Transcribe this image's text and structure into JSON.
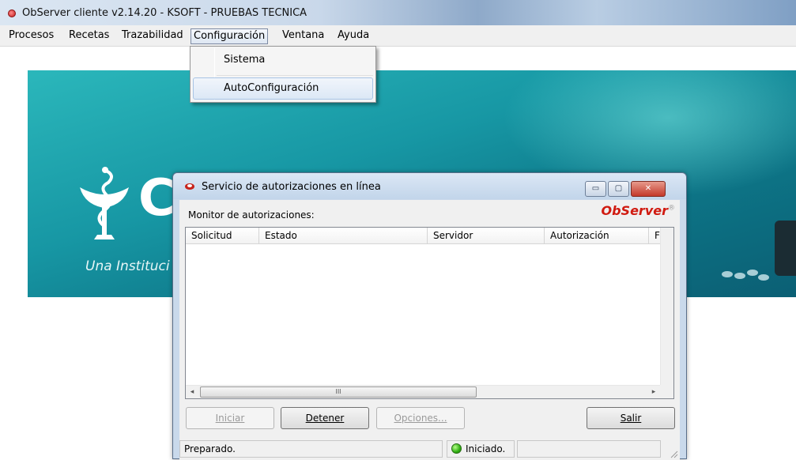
{
  "app": {
    "title": "ObServer cliente v2.14.20 - KSOFT - PRUEBAS TECNICA"
  },
  "menubar": {
    "items": [
      {
        "label": "Procesos"
      },
      {
        "label": "Recetas"
      },
      {
        "label": "Trazabilidad"
      },
      {
        "label": "Configuración",
        "active": true
      },
      {
        "label": "Ventana"
      },
      {
        "label": "Ayuda"
      }
    ]
  },
  "config_menu": {
    "items": [
      {
        "label": "Sistema"
      },
      {
        "label": "AutoConfiguración",
        "highlighted": true
      }
    ]
  },
  "banner": {
    "logo_text": "Cl",
    "slogan": "Una Instituci"
  },
  "dialog": {
    "title": "Servicio de autorizaciones en línea",
    "window_buttons": {
      "minimize": "▭",
      "maximize": "▢",
      "close": "✕"
    },
    "monitor_label": "Monitor de autorizaciones:",
    "brand": "ObServer",
    "brand_mark": "®",
    "columns": [
      "Solicitud",
      "Estado",
      "Servidor",
      "Autorización",
      "Fecl"
    ],
    "rows": [],
    "hscroll": {
      "left_arrow": "◂",
      "right_arrow": "▸",
      "thumb_grip": "III"
    },
    "buttons": {
      "iniciar": {
        "label": "Iniciar",
        "enabled": false
      },
      "detener": {
        "label": "Detener",
        "enabled": true
      },
      "opciones": {
        "label": "Opciones...",
        "enabled": false
      },
      "salir": {
        "label": "Salir",
        "enabled": true
      }
    },
    "status": {
      "left": "Preparado.",
      "service": "Iniciado.",
      "service_state_color": "#2fae12"
    }
  },
  "colors": {
    "banner_teal": "#1797a4",
    "brand_red": "#d01a10"
  }
}
